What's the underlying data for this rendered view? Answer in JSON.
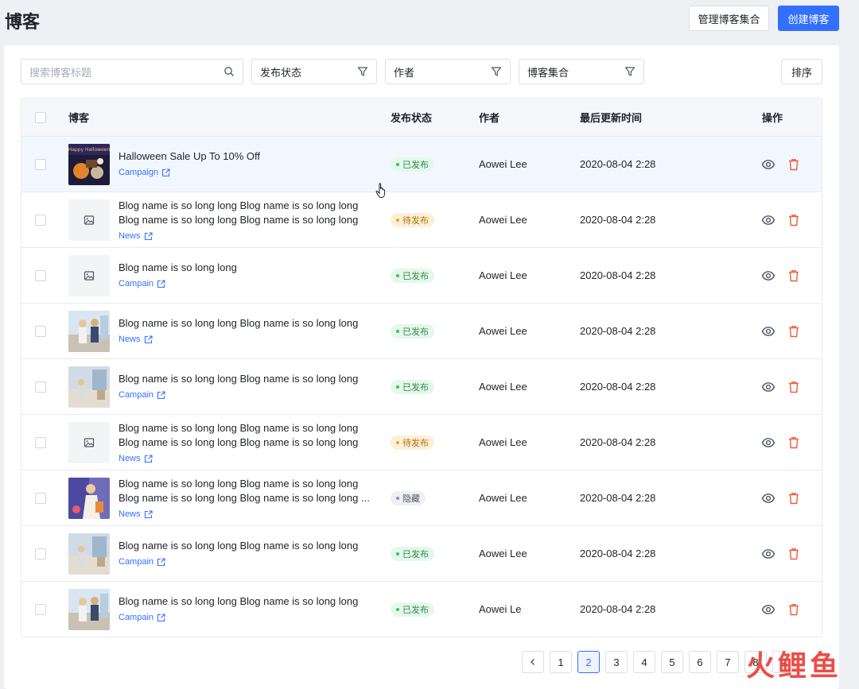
{
  "header": {
    "title": "博客",
    "manage_label": "管理博客集合",
    "create_label": "创建博客"
  },
  "filters": {
    "search_placeholder": "搜索博客标题",
    "status_label": "发布状态",
    "author_label": "作者",
    "collection_label": "博客集合",
    "sort_label": "排序"
  },
  "table": {
    "columns": {
      "blog": "博客",
      "status": "发布状态",
      "author": "作者",
      "updated": "最后更新时间",
      "actions": "操作"
    },
    "rows": [
      {
        "title1": "Halloween Sale Up To 10% Off",
        "title2": "",
        "tag": "Campaign",
        "status": "已发布",
        "status_kind": "published",
        "author": "Aowei Lee",
        "updated": "2020-08-04 2:28",
        "thumb": "halloween-image"
      },
      {
        "title1": "Blog name is so long long Blog name is so long long",
        "title2": "Blog name is so long long Blog name is so long long",
        "tag": "News",
        "status": "待发布",
        "status_kind": "pending",
        "author": "Aowei Lee",
        "updated": "2020-08-04 2:28",
        "thumb": "placeholder-image"
      },
      {
        "title1": "Blog name is so long long",
        "title2": "",
        "tag": "Campain",
        "status": "已发布",
        "status_kind": "published",
        "author": "Aowei Lee",
        "updated": "2020-08-04 2:28",
        "thumb": "placeholder-image"
      },
      {
        "title1": "Blog name is so long long Blog name is so long long",
        "title2": "",
        "tag": "News",
        "status": "已发布",
        "status_kind": "published",
        "author": "Aowei Lee",
        "updated": "2020-08-04 2:28",
        "thumb": "people-photo"
      },
      {
        "title1": "Blog name is so long long Blog name is so long long",
        "title2": "",
        "tag": "Campain",
        "status": "已发布",
        "status_kind": "published",
        "author": "Aowei Lee",
        "updated": "2020-08-04 2:28",
        "thumb": "street-photo"
      },
      {
        "title1": "Blog name is so long long Blog name is so long long",
        "title2": "Blog name is so long long Blog name is so long long",
        "tag": "News",
        "status": "待发布",
        "status_kind": "pending",
        "author": "Aowei Lee",
        "updated": "2020-08-04 2:28",
        "thumb": "placeholder-image"
      },
      {
        "title1": "Blog name is so long long Blog name is so long long",
        "title2": "Blog name is so long long Blog name is so long long ...",
        "tag": "News",
        "status": "隐藏",
        "status_kind": "hidden",
        "author": "Aowei Lee",
        "updated": "2020-08-04 2:28",
        "thumb": "illustration-photo"
      },
      {
        "title1": "Blog name is so long long Blog name is so long long",
        "title2": "",
        "tag": "Campain",
        "status": "已发布",
        "status_kind": "published",
        "author": "Aowei Lee",
        "updated": "2020-08-04 2:28",
        "thumb": "street-photo"
      },
      {
        "title1": "Blog name is so long long Blog name is so long long",
        "title2": "",
        "tag": "Campain",
        "status": "已发布",
        "status_kind": "published",
        "author": "Aowei Le",
        "updated": "2020-08-04 2:28",
        "thumb": "people-photo"
      }
    ]
  },
  "pagination": {
    "pages": [
      "1",
      "2",
      "3",
      "4",
      "5",
      "6",
      "7",
      "8",
      "9"
    ],
    "current": "2"
  },
  "watermark": "火鲤鱼",
  "colors": {
    "primary": "#3370ff",
    "danger": "#f05a3a",
    "published": "#34c759",
    "pending": "#f0a020"
  }
}
